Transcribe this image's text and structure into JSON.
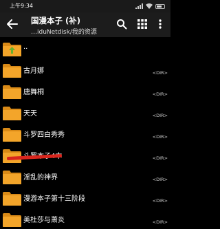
{
  "status_bar": {
    "time": "上午9:34"
  },
  "header": {
    "title": "国漫本子 (补)",
    "path": "…iduNetdisk/我的资源"
  },
  "parent_entry": {
    "label": ".."
  },
  "dir_tag": "<DIR>",
  "folders": [
    {
      "name": "古月娜"
    },
    {
      "name": "唐舞桐"
    },
    {
      "name": "天天"
    },
    {
      "name": "斗罗四白秀秀"
    },
    {
      "name": "斗罗本子4本"
    },
    {
      "name": "淫乱的神界"
    },
    {
      "name": "漫游本子第十三阶段"
    },
    {
      "name": "美杜莎与萧炎"
    }
  ],
  "colors": {
    "folder": "#f3a52a",
    "folder_tab": "#d98a17",
    "up_arrow": "#67b22d",
    "annotation": "#d9261d"
  }
}
